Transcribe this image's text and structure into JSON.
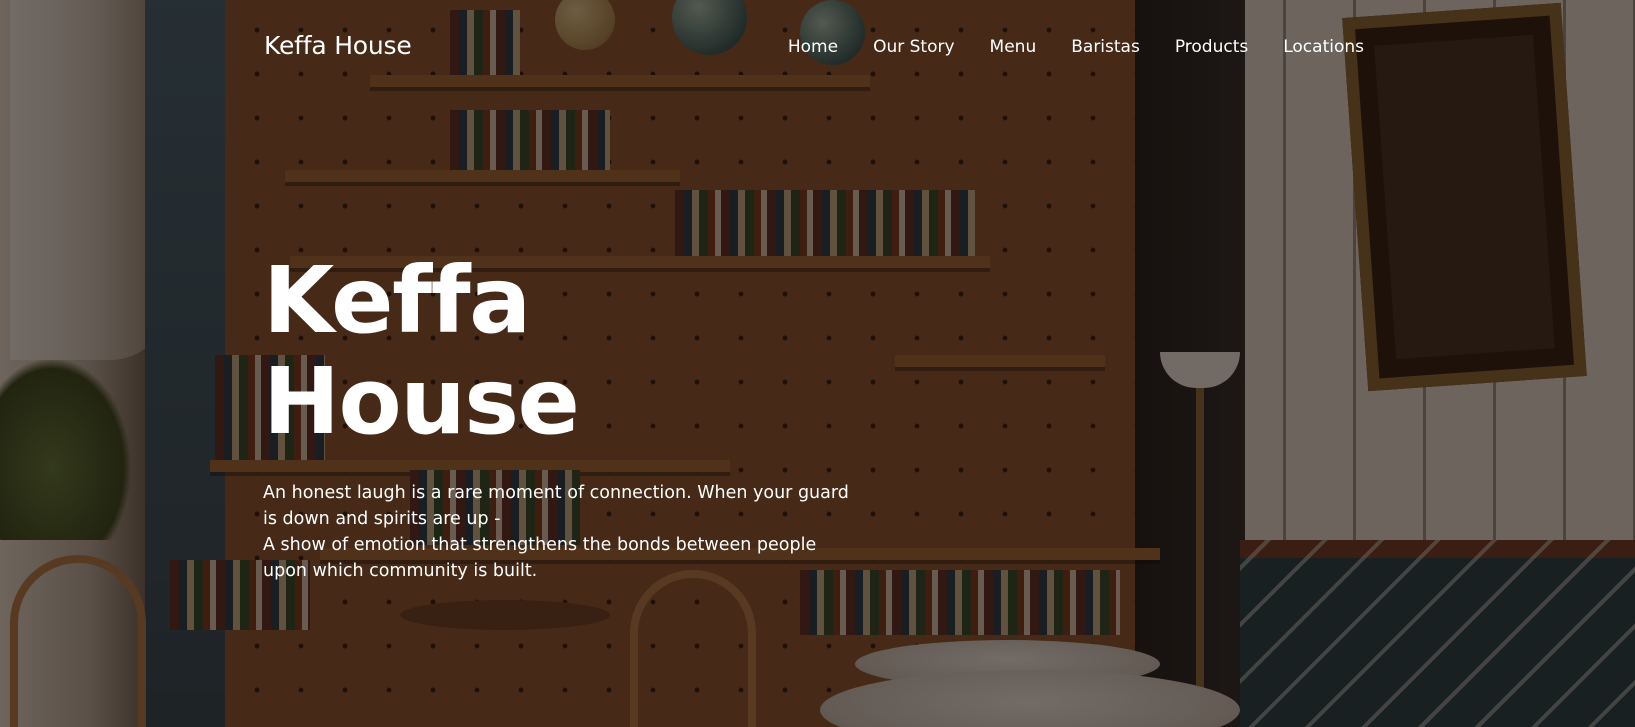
{
  "nav": {
    "brand": "Keffa House",
    "links": [
      {
        "label": "Home"
      },
      {
        "label": "Our Story"
      },
      {
        "label": "Menu"
      },
      {
        "label": "Baristas"
      },
      {
        "label": "Products"
      },
      {
        "label": "Locations"
      }
    ]
  },
  "hero": {
    "title": "Keffa House",
    "text_line1": "An honest laugh is a rare moment of connection. When your guard is down and spirits are up -",
    "text_line2": "A show of emotion that strengthens the bonds between people upon which community is built.",
    "background": "coffee-shop-interior-photo"
  },
  "colors": {
    "text": "#ffffff",
    "overlay": "#140a05"
  }
}
